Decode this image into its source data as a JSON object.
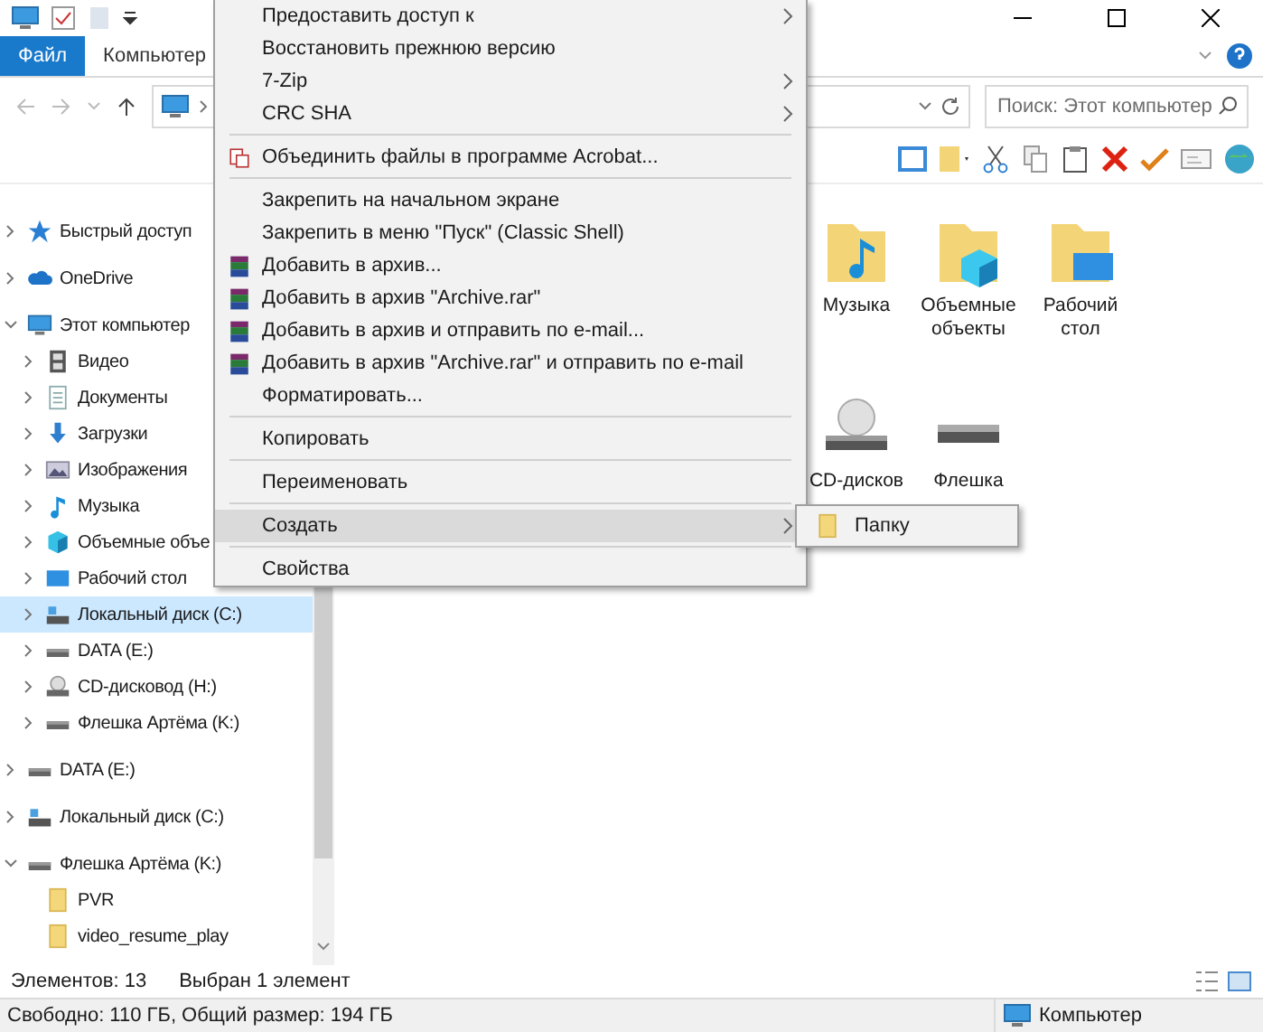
{
  "ribbon": {
    "tabs": [
      {
        "label": "Файл",
        "selected": true
      },
      {
        "label": "Компьютер",
        "selected": false
      }
    ]
  },
  "address_bar": {
    "search": {
      "placeholder": "Поиск: Этот компьютер"
    }
  },
  "sidebar": {
    "items": [
      {
        "label": "Быстрый доступ",
        "kind": "star",
        "expanded": false,
        "selected": false
      },
      {
        "label": "OneDrive",
        "kind": "cloud",
        "expanded": false,
        "selected": false
      },
      {
        "label": "Этот компьютер",
        "kind": "pc",
        "expanded": true,
        "selected": false,
        "children": [
          {
            "label": "Видео",
            "kind": "video",
            "expanded": false,
            "selected": false
          },
          {
            "label": "Документы",
            "kind": "docs",
            "expanded": false,
            "selected": false
          },
          {
            "label": "Загрузки",
            "kind": "download",
            "expanded": false,
            "selected": false
          },
          {
            "label": "Изображения",
            "kind": "pictures",
            "expanded": false,
            "selected": false
          },
          {
            "label": "Музыка",
            "kind": "music",
            "expanded": false,
            "selected": false
          },
          {
            "label": "Объемные объе",
            "kind": "cube",
            "expanded": false,
            "selected": false
          },
          {
            "label": "Рабочий стол",
            "kind": "desktop",
            "expanded": false,
            "selected": false
          },
          {
            "label": "Локальный диск (C:)",
            "kind": "system-drive",
            "expanded": false,
            "selected": true
          },
          {
            "label": "DATA (E:)",
            "kind": "drive",
            "expanded": false,
            "selected": false
          },
          {
            "label": "CD-дисковод (H:)",
            "kind": "cd",
            "expanded": false,
            "selected": false
          },
          {
            "label": "Флешка Артёма (K:)",
            "kind": "drive",
            "expanded": false,
            "selected": false
          }
        ]
      },
      {
        "label": "DATA (E:)",
        "kind": "drive",
        "expanded": false,
        "selected": false
      },
      {
        "label": "Локальный диск (C:)",
        "kind": "system-drive",
        "expanded": false,
        "selected": false
      },
      {
        "label": "Флешка Артёма (K:)",
        "kind": "drive",
        "expanded": true,
        "selected": false,
        "children": [
          {
            "label": "PVR",
            "kind": "folder",
            "selected": false
          },
          {
            "label": "video_resume_play",
            "kind": "folder",
            "selected": false
          }
        ]
      }
    ]
  },
  "content": {
    "groups": [
      {
        "items": [
          {
            "label": "Музыка",
            "kind": "music"
          },
          {
            "label": "Объемные объекты",
            "kind": "cube"
          },
          {
            "label": "Рабочий стол",
            "kind": "desktop"
          }
        ]
      },
      {
        "items": [
          {
            "label": "CD-дисков",
            "kind": "cd"
          },
          {
            "label": "Флешка",
            "kind": "drive"
          }
        ]
      }
    ]
  },
  "status_bar": {
    "count": "Элементов: 13",
    "selection": "Выбран 1 элемент"
  },
  "details_bar": {
    "free_space": "Свободно: 110 ГБ, Общий размер: 194 ГБ",
    "location": "Компьютер"
  },
  "context_menu": {
    "items": [
      {
        "kind": "item",
        "label": "Предоставить доступ к",
        "submenu": true,
        "selected": false
      },
      {
        "kind": "item",
        "label": "Восстановить прежнюю версию",
        "submenu": false,
        "selected": false
      },
      {
        "kind": "item",
        "label": "7-Zip",
        "submenu": true,
        "selected": false
      },
      {
        "kind": "item",
        "label": "CRC SHA",
        "submenu": true,
        "selected": false
      },
      {
        "kind": "separator"
      },
      {
        "kind": "acrobat",
        "label": "Объединить файлы в программе Acrobat...",
        "submenu": false,
        "selected": false
      },
      {
        "kind": "separator"
      },
      {
        "kind": "item",
        "label": "Закрепить на начальном экране",
        "submenu": false,
        "selected": false
      },
      {
        "kind": "item",
        "label": "Закрепить в меню \"Пуск\" (Classic Shell)",
        "submenu": false,
        "selected": false
      },
      {
        "kind": "archive",
        "label": "Добавить в архив...",
        "submenu": false,
        "selected": false
      },
      {
        "kind": "archive",
        "label": "Добавить в архив \"Archive.rar\"",
        "submenu": false,
        "selected": false
      },
      {
        "kind": "archive",
        "label": "Добавить в архив и отправить по e-mail...",
        "submenu": false,
        "selected": false
      },
      {
        "kind": "archive",
        "label": "Добавить в архив \"Archive.rar\" и отправить по e-mail",
        "submenu": false,
        "selected": false
      },
      {
        "kind": "item",
        "label": "Форматировать...",
        "submenu": false,
        "selected": false
      },
      {
        "kind": "separator"
      },
      {
        "kind": "item",
        "label": "Копировать",
        "submenu": false,
        "selected": false
      },
      {
        "kind": "separator"
      },
      {
        "kind": "item",
        "label": "Переименовать",
        "submenu": false,
        "selected": false
      },
      {
        "kind": "separator"
      },
      {
        "kind": "item",
        "label": "Создать",
        "submenu": true,
        "selected": true
      },
      {
        "kind": "separator"
      },
      {
        "kind": "item",
        "label": "Свойства",
        "submenu": false,
        "selected": false
      }
    ]
  },
  "submenu": {
    "items": [
      {
        "label": "Папку",
        "kind": "folder"
      }
    ]
  }
}
